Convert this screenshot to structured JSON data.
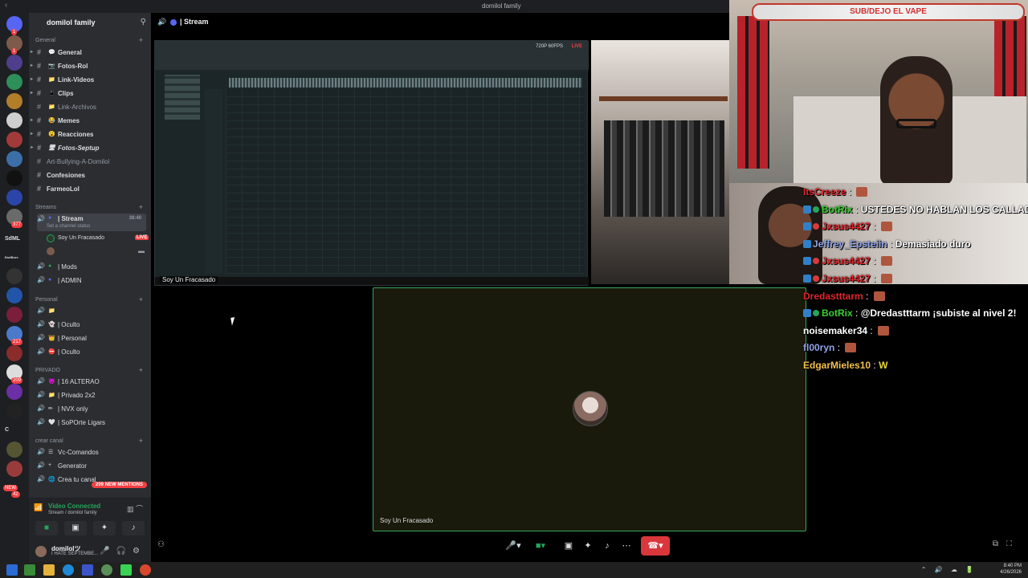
{
  "window": {
    "title": "domilol family"
  },
  "server": {
    "name": "domilol family",
    "categories": {
      "general": "General",
      "streams": "Streams",
      "personal": "Personal",
      "privado": "PRIVADO",
      "crear": "crear canal"
    },
    "general_channels": [
      {
        "label": "General",
        "emoji": "💬"
      },
      {
        "label": "Fotos-Rol",
        "emoji": "📷"
      },
      {
        "label": "Link-Videos",
        "emoji": "📁"
      },
      {
        "label": "Clips",
        "emoji": "📱"
      },
      {
        "label": "Link-Archivos",
        "emoji": "📁"
      },
      {
        "label": "Memes",
        "emoji": "😂"
      },
      {
        "label": "Reacciones",
        "emoji": "😮"
      },
      {
        "label": "Fotos-Septup",
        "emoji": "🖥"
      },
      {
        "label": "Art-Bullying-A-Domilol",
        "emoji": "😜"
      },
      {
        "label": "Confesiones",
        "emoji": ""
      },
      {
        "label": "FarmeoLol",
        "emoji": ""
      }
    ],
    "stream_channel": {
      "label": "| Stream",
      "time": "38:40",
      "status": "Set a channel status"
    },
    "stream_user": {
      "name": "Soy Un Fracasado",
      "live": "LIVE"
    },
    "voice_channels": [
      {
        "label": "| Mods"
      },
      {
        "label": "| ADMIN"
      }
    ],
    "personal_channels": [
      {
        "label": ""
      },
      {
        "label": "| Oculto"
      },
      {
        "label": "| Personal"
      },
      {
        "label": "| Oculto"
      }
    ],
    "privado_channels": [
      {
        "label": "| 16 ALTERAO"
      },
      {
        "label": "| Privado 2x2"
      },
      {
        "label": "| NVX only"
      },
      {
        "label": "| SoPOrte Ligars"
      }
    ],
    "crear_channels": [
      {
        "label": "Vc-Comandos"
      },
      {
        "label": "Generator"
      },
      {
        "label": "Crea tu canal"
      }
    ],
    "mentions_pill": "209 NEW MENTIONS"
  },
  "rail": {
    "badges": [
      "1",
      "1",
      "1",
      "1",
      "1",
      "1",
      "1",
      "1",
      "1",
      "1",
      "1",
      "377",
      "1",
      "1",
      "217",
      "1",
      "209",
      "1",
      "1",
      "1",
      "42"
    ],
    "labels": [
      "SdML",
      "EarlBore",
      "C",
      "NEW"
    ]
  },
  "voice": {
    "status": "Video Connected",
    "sub": "Stream / domilol family"
  },
  "user": {
    "name": "domilolツ",
    "status": "I HATE SEPTEMBE..."
  },
  "main": {
    "header_title": "| Stream",
    "screen_share_label": "Soy Un Fracasado",
    "screen_fps": "720P 60FPS",
    "screen_live": "LIVE",
    "cam_label": "Soy Un Fracasado"
  },
  "overlay": {
    "banner": "SUB/DEJO EL VAPE",
    "chat": [
      {
        "user": "ItsCreeze",
        "color": "#e0262b",
        "badges": [],
        "text": "",
        "emote": true
      },
      {
        "user": "BotRix",
        "color": "#37d12c",
        "badges": [
          "b",
          "v"
        ],
        "text": "USTEDES NO HABLAN LOS CALLADOS?",
        "emote": false
      },
      {
        "user": "Jxsus4427",
        "color": "#e0262b",
        "badges": [
          "b",
          "r"
        ],
        "text": "",
        "emote": true
      },
      {
        "user": "Jeffrey_Epsteiin",
        "color": "#8ea3e8",
        "badges": [
          "b"
        ],
        "text": "Demasiado duro",
        "emote": false
      },
      {
        "user": "Jxsus4427",
        "color": "#e0262b",
        "badges": [
          "b",
          "r"
        ],
        "text": "",
        "emote": true
      },
      {
        "user": "Jxsus4427",
        "color": "#e0262b",
        "badges": [
          "b",
          "r"
        ],
        "text": "",
        "emote": true
      },
      {
        "user": "Dredastttarm",
        "color": "#e0262b",
        "badges": [],
        "text": "",
        "emote": true
      },
      {
        "user": "BotRix",
        "color": "#37d12c",
        "badges": [
          "b",
          "v"
        ],
        "text": "@Dredastttarm ¡subiste al nivel 2!",
        "emote": false
      },
      {
        "user": "noisemaker34",
        "color": "#ffffff",
        "badges": [],
        "text": "",
        "emote": true
      },
      {
        "user": "fl00ryn",
        "color": "#8ea3e8",
        "badges": [],
        "text": "",
        "emote": true
      },
      {
        "user": "EdgarMieles10",
        "color": "#f2c14a",
        "badges": [],
        "text": "W",
        "emote": false
      }
    ]
  },
  "taskbar": {
    "time": "8:40 PM",
    "date": "4/26/2026"
  }
}
